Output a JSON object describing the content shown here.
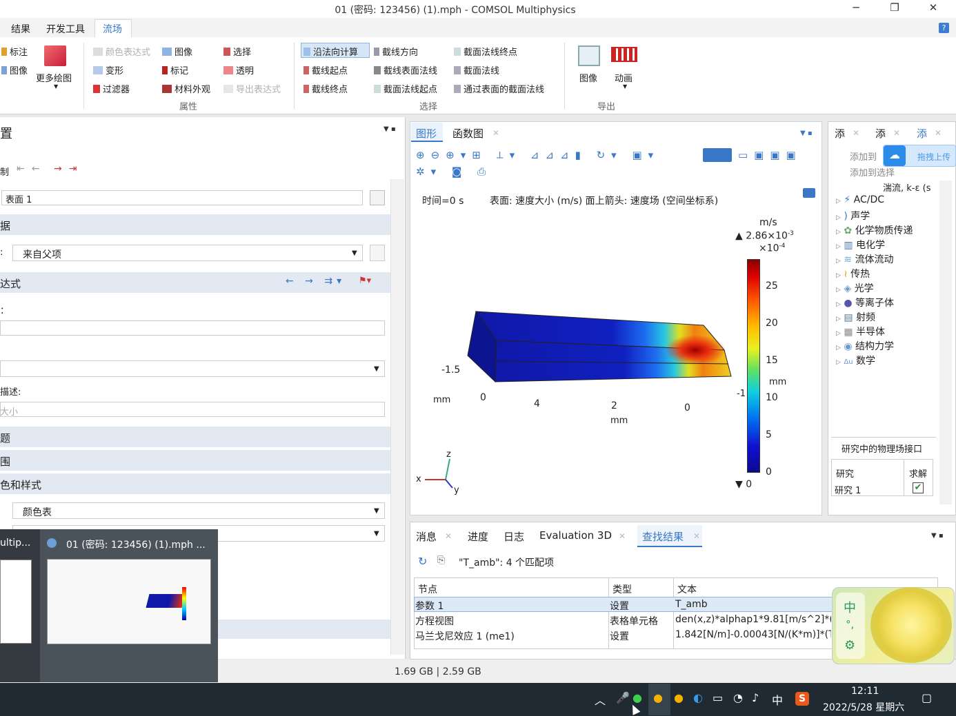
{
  "window": {
    "title": "01 (密码: 123456) (1).mph - COMSOL Multiphysics",
    "minimize": "─",
    "restore": "❐",
    "close": "✕"
  },
  "menu": {
    "items": [
      "结果",
      "开发工具",
      "流场"
    ],
    "help": "?"
  },
  "ribbon": {
    "col1": [
      "标注",
      "图像"
    ],
    "more_plots": "更多绘图",
    "props": {
      "row1": [
        "颜色表达式",
        "图像",
        "选择"
      ],
      "row2": [
        "变形",
        "标记",
        "透明"
      ],
      "row3": [
        "过滤器",
        "材料外观",
        "导出表达式"
      ],
      "label": "属性"
    },
    "select": {
      "row1": [
        "沿法向计算",
        "截线方向",
        "截面法线终点"
      ],
      "row2": [
        "截线起点",
        "截线表面法线",
        "截面法线"
      ],
      "row3": [
        "截线终点",
        "截面法线起点",
        "通过表面的截面法线"
      ],
      "label": "选择"
    },
    "export": {
      "items": [
        "图像",
        "动画"
      ],
      "label": "导出"
    }
  },
  "left": {
    "header": "置",
    "nav_label": "制",
    "label_value": "表面 1",
    "sections": [
      "据",
      "达式",
      "题",
      "围",
      "色和样式"
    ],
    "dataset_prefix": ":",
    "dataset_value": "来自父项",
    "expr_label": "：",
    "desc_label": "描述:",
    "desc_value": "大小",
    "color_label": "颜色表"
  },
  "graphics": {
    "tabs": [
      "图形",
      "函数图"
    ],
    "info_time": "时间=0 s",
    "info_desc": "表面: 速度大小 (m/s)  面上箭头: 速度场 (空间坐标系)",
    "unit": "m/s",
    "max_label": "▲ 2.86×10",
    "max_exp": "-3",
    "scale_label": "×10",
    "scale_exp": "-4",
    "min_label": "▼ 0",
    "ticks": [
      "25",
      "20",
      "15",
      "10",
      "5",
      "0"
    ],
    "axis": {
      "a": "-1.5",
      "b": "mm",
      "c": "0",
      "d": "4",
      "e": "2",
      "f": "mm",
      "g": "0",
      "h": "-1",
      "i": "mm"
    },
    "triad": {
      "z": "z",
      "x": "x",
      "y": "y"
    }
  },
  "right": {
    "tabs": [
      "添",
      "添",
      "添"
    ],
    "add_to": "添加到",
    "add_sel": "添加到选择",
    "drag_upload": "拖拽上传",
    "items": [
      "湍流, k-ε (s",
      "AC/DC",
      "声学",
      "化学物质传递",
      "电化学",
      "流体流动",
      "传热",
      "光学",
      "等离子体",
      "射频",
      "半导体",
      "结构力学",
      "数学"
    ],
    "study_section": "研究中的物理场接口",
    "study_col1": "研究",
    "study_col2": "求解",
    "study_row": "研究 1"
  },
  "bottom": {
    "tabs": [
      "消息",
      "进度",
      "日志",
      "Evaluation 3D",
      "查找结果"
    ],
    "search_result": "\"T_amb\": 4 个匹配项",
    "columns": [
      "节点",
      "类型",
      "文本"
    ],
    "rows": [
      [
        "参数 1",
        "设置",
        "T_amb"
      ],
      [
        "方程视图",
        "表格单元格",
        "den(x,z)*alphap1*9.81[m/s^2]*(T"
      ],
      [
        "马兰戈尼效应 1 (me1)",
        "设置",
        "1.842[N/m]-0.00043[N/(K*m)]*(T"
      ]
    ]
  },
  "status": {
    "memory": "1.69 GB | 2.59 GB"
  },
  "taskbar": {
    "thumb1_title": "ultip...",
    "thumb2_title": "01 (密码: 123456) (1).mph ...",
    "time": "12:11",
    "date": "2022/5/28 星期六",
    "ime": "中"
  },
  "note": {
    "ime": "中",
    "dot": "°,"
  }
}
